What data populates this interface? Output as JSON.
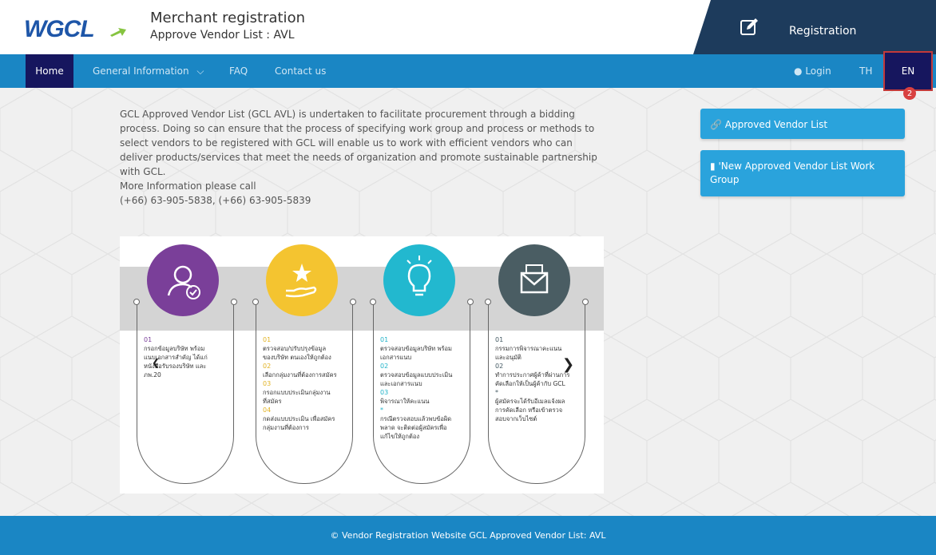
{
  "header": {
    "logo": "WGCL",
    "title": "Merchant registration",
    "subtitle": "Approve Vendor List : AVL",
    "registration_label": "Registration",
    "registration_icon": "edit-icon"
  },
  "nav": {
    "home": "Home",
    "general_info": "General Information",
    "faq": "FAQ",
    "contact": "Contact us",
    "login": "Login",
    "th": "TH",
    "en": "EN",
    "badge_count": "2"
  },
  "main": {
    "intro": "GCL Approved Vendor List (GCL AVL) is undertaken to facilitate procurement through a bidding process. Doing so can ensure that the process of specifying work group and process or methods to select vendors to be registered with GCL will enable us to work with efficient vendors who can deliver products/services that meet the needs of organization and promote sustainable partnership with GCL.",
    "more_info": "More Information please call",
    "phones": "(+66) 63-905-5838, (+66) 63-905-5839"
  },
  "sidebar": {
    "approved_vendor_list": "Approved Vendor List",
    "new_avl_work_group": "'New Approved Vendor List Work Group"
  },
  "infographic": {
    "colors": {
      "step1": "#7a3f99",
      "step2": "#f4c430",
      "step3": "#22b8cf",
      "step4": "#4a5d63"
    },
    "steps": [
      {
        "icon": "user-check-icon",
        "lines": [
          [
            "01",
            "กรอกข้อมูลบริษัท พร้อม"
          ],
          [
            "",
            "แนบเอกสารสำคัญ ได้แก่"
          ],
          [
            "",
            "หนังสือรับรองบริษัท และ"
          ],
          [
            "",
            "ภพ.20"
          ]
        ]
      },
      {
        "icon": "hand-star-icon",
        "lines": [
          [
            "01",
            "ตรวจสอบ/ปรับปรุงข้อมูล"
          ],
          [
            "",
            "ของบริษัท ตนเองให้ถูกต้อง"
          ],
          [
            "02",
            "เลือกกลุ่มงานที่ต้องการสมัคร"
          ],
          [
            "03",
            "กรอกแบบประเมินกลุ่มงาน"
          ],
          [
            "",
            "ที่สมัคร"
          ],
          [
            "04",
            "กดส่งแบบประเมิน เพื่อสมัคร"
          ],
          [
            "",
            "กลุ่มงานที่ต้องการ"
          ]
        ]
      },
      {
        "icon": "lightbulb-icon",
        "lines": [
          [
            "01",
            "ตรวจสอบข้อมูลบริษัท พร้อม"
          ],
          [
            "",
            "เอกสารแนบ"
          ],
          [
            "02",
            "ตรวจสอบข้อมูลแบบประเมิน"
          ],
          [
            "",
            "และเอกสารแนบ"
          ],
          [
            "03",
            "พิจารณาให้คะแนน"
          ],
          [
            "*",
            "กรณีตรวจสอบแล้วพบข้อผิด"
          ],
          [
            "",
            "พลาด จะติดต่อผู้สมัครเพื่อ"
          ],
          [
            "",
            "แก้ไขให้ถูกต้อง"
          ]
        ]
      },
      {
        "icon": "envelope-icon",
        "lines": [
          [
            "01",
            "กรรมการพิจารณาคะแนน"
          ],
          [
            "",
            "และอนุมัติ"
          ],
          [
            "02",
            "ทำการประกาศผู้ค้าที่ผ่านการ"
          ],
          [
            "",
            "คัดเลือกให้เป็นผู้ค้ากับ GCL"
          ],
          [
            "*",
            "ผู้สมัครจะได้รับอีเมลแจ้งผล"
          ],
          [
            "",
            "การคัดเลือก หรือเข้าตรวจ"
          ],
          [
            "",
            "สอบจากเว็บไซต์"
          ]
        ]
      }
    ]
  },
  "footer": {
    "text": "© Vendor Registration Website GCL Approved Vendor List: AVL"
  }
}
